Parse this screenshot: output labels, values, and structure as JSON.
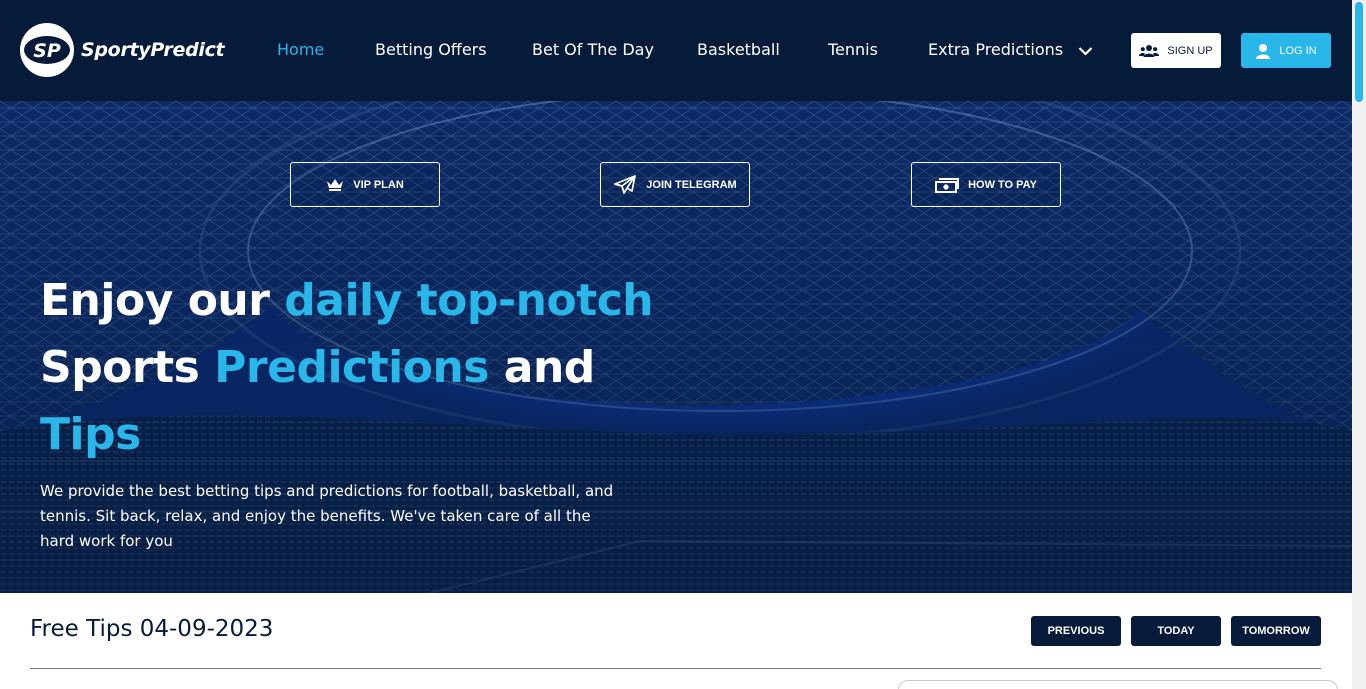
{
  "brand": {
    "logo_initials": "SP",
    "name": "SportyPredict"
  },
  "nav": {
    "items": [
      {
        "label": "Home",
        "active": true
      },
      {
        "label": "Betting Offers",
        "active": false
      },
      {
        "label": "Bet Of The Day",
        "active": false
      },
      {
        "label": "Basketball",
        "active": false
      },
      {
        "label": "Tennis",
        "active": false
      },
      {
        "label": "Extra Predictions",
        "active": false,
        "dropdown": true
      }
    ]
  },
  "auth": {
    "signup_label": "SIGN UP",
    "login_label": "LOG IN"
  },
  "hero": {
    "buttons": [
      {
        "label": "VIP PLAN",
        "icon": "crown-icon"
      },
      {
        "label": "JOIN TELEGRAM",
        "icon": "paper-plane-icon"
      },
      {
        "label": "HOW TO PAY",
        "icon": "money-icon"
      }
    ],
    "title": {
      "part1": "Enjoy our ",
      "part2": "daily top-notch",
      "part3": "Sports ",
      "part4": "Predictions",
      "part5": " and",
      "part6": "Tips"
    },
    "description": "We provide the best betting tips and predictions for football, basketball, and tennis. Sit back, relax, and enjoy the benefits. We've taken care of all the hard work for you"
  },
  "tips": {
    "title": "Free Tips 04-09-2023",
    "buttons": [
      "PREVIOUS",
      "TODAY",
      "TOMORROW"
    ]
  },
  "colors": {
    "navy": "#061a3a",
    "accent": "#29b6e8",
    "white": "#ffffff"
  }
}
